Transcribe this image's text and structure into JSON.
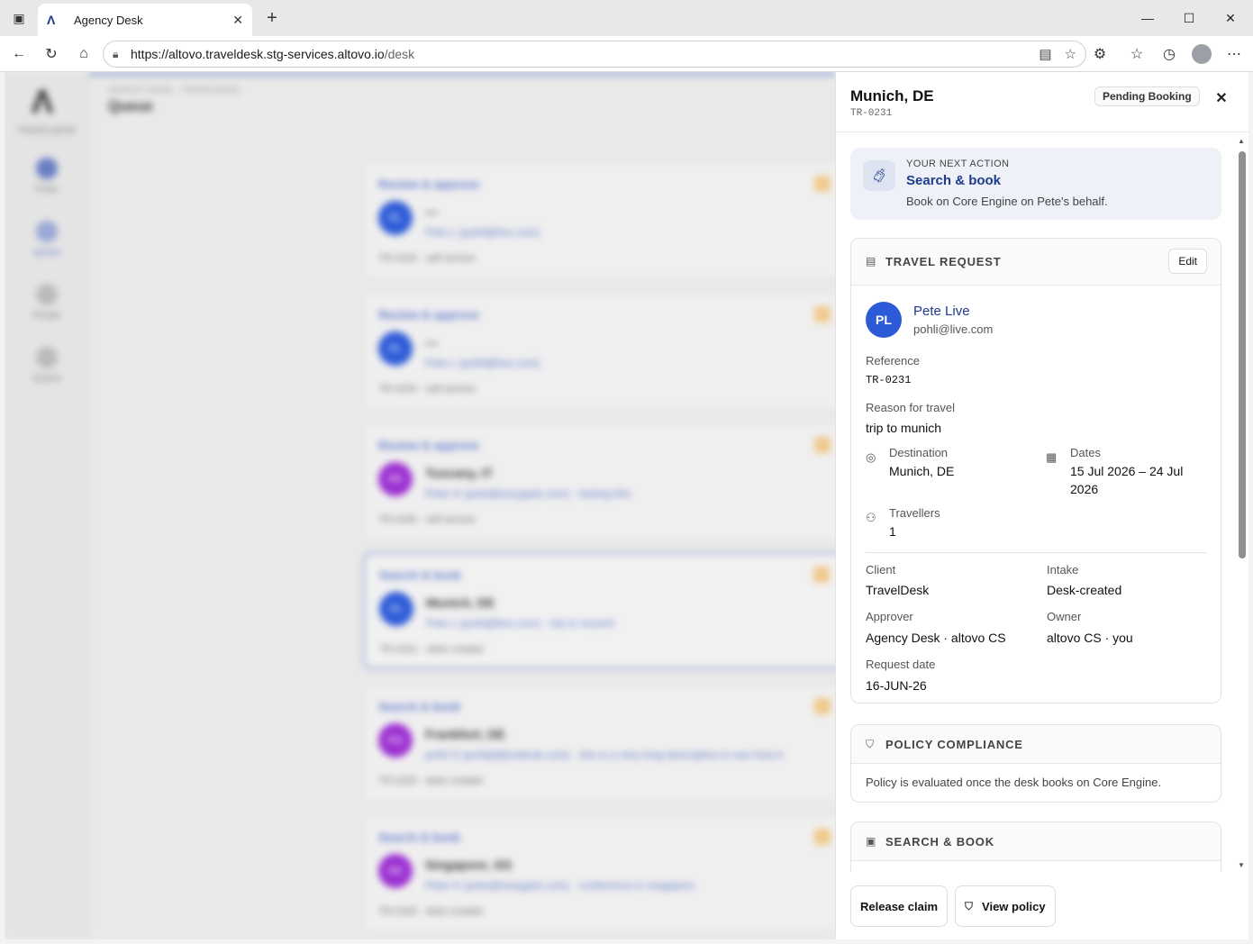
{
  "browser": {
    "tab_title": "Agency Desk",
    "url_host": "https://altovo.traveldesk.stg-services.altovo.io",
    "url_path": "/desk"
  },
  "background": {
    "app_label": "TRAVELDESK",
    "breadcrumb": "AGENCY DESK · TRAVELDESK",
    "page_title": "Queue",
    "nav": [
      {
        "label": "Pulse"
      },
      {
        "label": "Queue"
      },
      {
        "label": "People"
      },
      {
        "label": "Search"
      }
    ],
    "cards": [
      {
        "action": "Review & approve",
        "initials": "PL",
        "name": "—",
        "email": "Pete L (pohli@live.com)",
        "foot": "TR-0233 · self service"
      },
      {
        "action": "Review & approve",
        "initials": "PL",
        "name": "—",
        "email": "Pete L (pohli@live.com)",
        "foot": "TR-0234 · self service"
      },
      {
        "action": "Review & approve",
        "initials": "PK",
        "name": "Tuscany, IT",
        "email": "Peter K (pete@sexygele.com) · testing this",
        "foot": "TR-0235 · self service"
      },
      {
        "action": "Search & book",
        "initials": "PL",
        "name": "Munich, DE",
        "email": "Pete L (pohli@live.com) · trip to munich",
        "foot": "TR-0231 · desk created"
      },
      {
        "action": "Search & book",
        "initials": "PO",
        "name": "Frankfurt, DE",
        "email": "pohli O (pohlipl@outlook.com) · this is a very long description to see how it",
        "foot": "TR-0229 · desk created"
      },
      {
        "action": "Search & book",
        "initials": "PK",
        "name": "Singapore, SG",
        "email": "Peter K (pete@sexygele.com) · conference in singapore",
        "foot": "TR-0228 · desk created"
      }
    ]
  },
  "panel": {
    "title": "Munich, DE",
    "reference": "TR-0231",
    "status": "Pending Booking",
    "next_action": {
      "label": "YOUR NEXT ACTION",
      "title": "Search & book",
      "description": "Book on Core Engine on Pete's behalf."
    },
    "travel_request": {
      "heading": "TRAVEL REQUEST",
      "edit_label": "Edit",
      "initials": "PL",
      "name": "Pete Live",
      "email": "pohli@live.com",
      "reference_label": "Reference",
      "reference": "TR-0231",
      "reason_label": "Reason for travel",
      "reason": "trip to munich",
      "destination_label": "Destination",
      "destination": "Munich, DE",
      "dates_label": "Dates",
      "dates_line1": "15 Jul 2026 – 24 Jul",
      "dates_line2": "2026",
      "travellers_label": "Travellers",
      "travellers": "1",
      "client_label": "Client",
      "client": "TravelDesk",
      "intake_label": "Intake",
      "intake": "Desk-created",
      "approver_label": "Approver",
      "approver": "Agency Desk · altovo CS",
      "owner_label": "Owner",
      "owner": "altovo CS · you",
      "request_date_label": "Request date",
      "request_date": "16-JUN-26"
    },
    "policy": {
      "heading": "POLICY COMPLIANCE",
      "text": "Policy is evaluated once the desk books on Core Engine."
    },
    "search_book": {
      "heading": "SEARCH & BOOK"
    },
    "footer": {
      "release_label": "Release claim",
      "view_policy_label": "View policy"
    }
  }
}
